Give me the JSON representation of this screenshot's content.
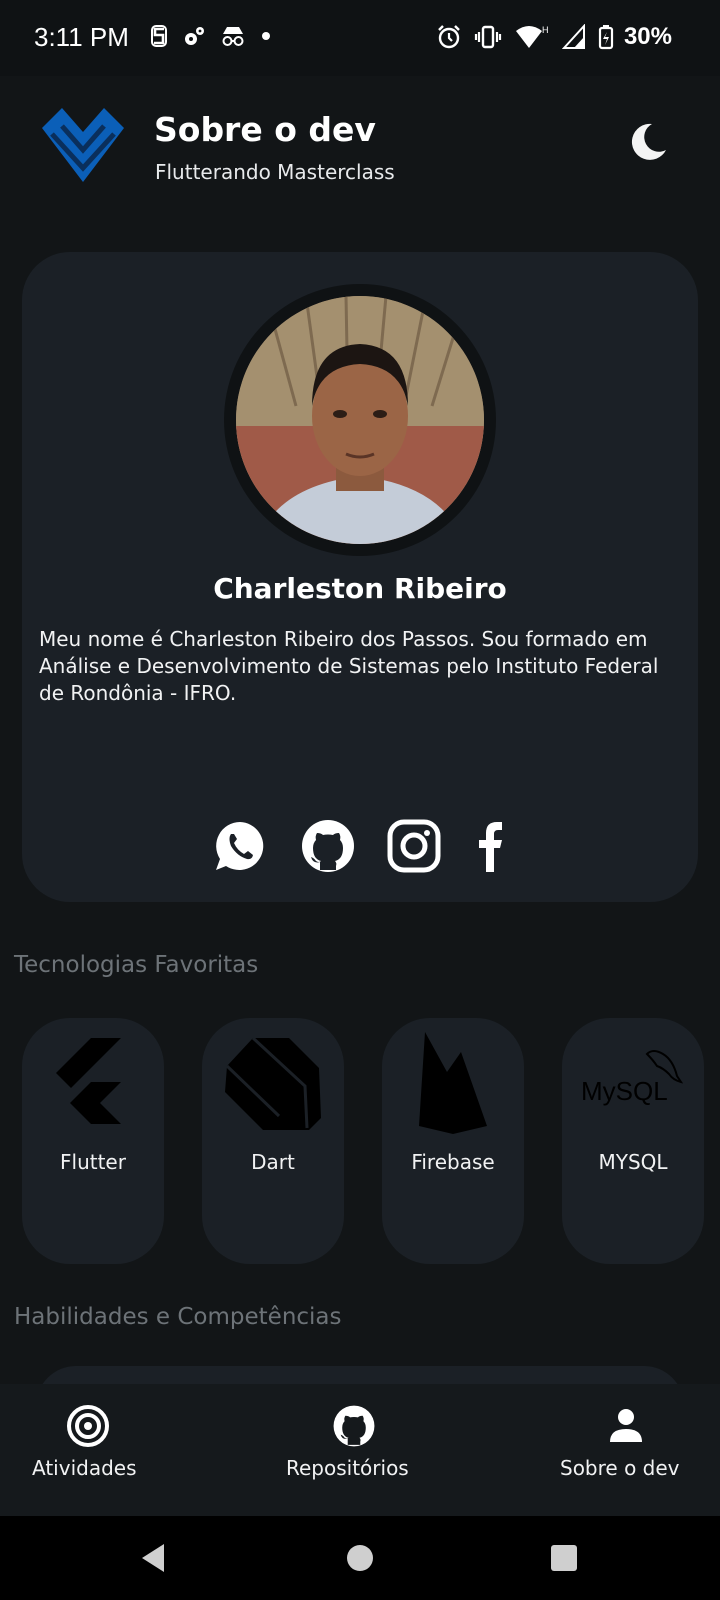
{
  "status_bar": {
    "time": "3:11 PM",
    "battery": "30%",
    "left_icons": [
      "s-icon",
      "settings-cluster-icon",
      "incognito-icon",
      "dot-icon"
    ],
    "right_icons": [
      "alarm-icon",
      "vibrate-icon",
      "wifi-icon",
      "signal-icon",
      "battery-icon"
    ]
  },
  "header": {
    "title": "Sobre o dev",
    "subtitle": "Flutterando Masterclass",
    "logo_icon": "flutterando-logo-icon",
    "theme_icon": "moon-icon"
  },
  "profile": {
    "name": "Charleston Ribeiro",
    "bio": "Meu nome é Charleston Ribeiro dos Passos. Sou formado em Análise e Desenvolvimento de Sistemas pelo Instituto Federal de Rondônia - IFRO.",
    "socials": [
      "whatsapp-icon",
      "github-icon",
      "instagram-icon",
      "facebook-icon"
    ]
  },
  "sections": {
    "favorites_title": "Tecnologias Favoritas",
    "skills_title": "Habilidades e Competências"
  },
  "technologies": [
    {
      "label": "Flutter",
      "icon": "flutter-icon"
    },
    {
      "label": "Dart",
      "icon": "dart-icon"
    },
    {
      "label": "Firebase",
      "icon": "firebase-icon"
    },
    {
      "label": "MYSQL",
      "icon": "mysql-icon"
    }
  ],
  "bottom_nav": [
    {
      "label": "Atividades",
      "icon": "target-icon"
    },
    {
      "label": "Repositórios",
      "icon": "github-icon"
    },
    {
      "label": "Sobre o dev",
      "icon": "person-icon"
    }
  ],
  "colors": {
    "background": "#121517",
    "card": "#1b2026",
    "logo_blue": "#0b5fb8",
    "muted_text": "#6d7378"
  }
}
